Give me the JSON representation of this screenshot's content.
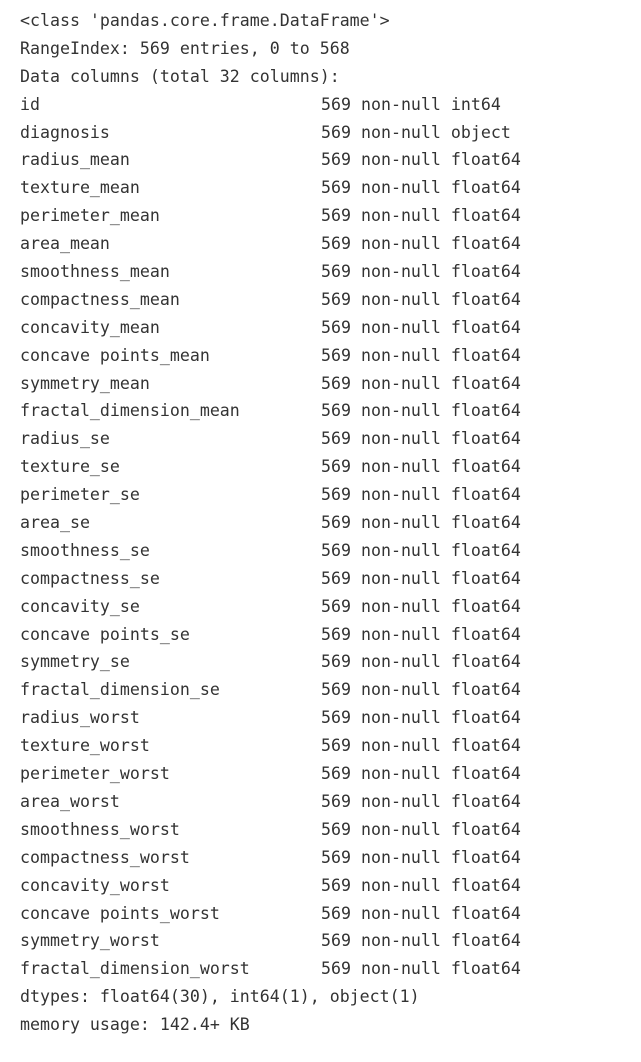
{
  "output": {
    "kind": "pandas-dataframe-info",
    "header_lines": [
      "<class 'pandas.core.frame.DataFrame'>",
      "RangeIndex: 569 entries, 0 to 568",
      "Data columns (total 32 columns):"
    ],
    "class_line": "<class 'pandas.core.frame.DataFrame'>",
    "range_index_line": "RangeIndex: 569 entries, 0 to 568",
    "data_columns_line": "Data columns (total 32 columns):",
    "non_null_label": "non-null",
    "entry_count": "569",
    "total_columns": "32",
    "columns": [
      {
        "name": "id",
        "count": "569",
        "non_null": "non-null",
        "dtype": "int64"
      },
      {
        "name": "diagnosis",
        "count": "569",
        "non_null": "non-null",
        "dtype": "object"
      },
      {
        "name": "radius_mean",
        "count": "569",
        "non_null": "non-null",
        "dtype": "float64"
      },
      {
        "name": "texture_mean",
        "count": "569",
        "non_null": "non-null",
        "dtype": "float64"
      },
      {
        "name": "perimeter_mean",
        "count": "569",
        "non_null": "non-null",
        "dtype": "float64"
      },
      {
        "name": "area_mean",
        "count": "569",
        "non_null": "non-null",
        "dtype": "float64"
      },
      {
        "name": "smoothness_mean",
        "count": "569",
        "non_null": "non-null",
        "dtype": "float64"
      },
      {
        "name": "compactness_mean",
        "count": "569",
        "non_null": "non-null",
        "dtype": "float64"
      },
      {
        "name": "concavity_mean",
        "count": "569",
        "non_null": "non-null",
        "dtype": "float64"
      },
      {
        "name": "concave points_mean",
        "count": "569",
        "non_null": "non-null",
        "dtype": "float64"
      },
      {
        "name": "symmetry_mean",
        "count": "569",
        "non_null": "non-null",
        "dtype": "float64"
      },
      {
        "name": "fractal_dimension_mean",
        "count": "569",
        "non_null": "non-null",
        "dtype": "float64"
      },
      {
        "name": "radius_se",
        "count": "569",
        "non_null": "non-null",
        "dtype": "float64"
      },
      {
        "name": "texture_se",
        "count": "569",
        "non_null": "non-null",
        "dtype": "float64"
      },
      {
        "name": "perimeter_se",
        "count": "569",
        "non_null": "non-null",
        "dtype": "float64"
      },
      {
        "name": "area_se",
        "count": "569",
        "non_null": "non-null",
        "dtype": "float64"
      },
      {
        "name": "smoothness_se",
        "count": "569",
        "non_null": "non-null",
        "dtype": "float64"
      },
      {
        "name": "compactness_se",
        "count": "569",
        "non_null": "non-null",
        "dtype": "float64"
      },
      {
        "name": "concavity_se",
        "count": "569",
        "non_null": "non-null",
        "dtype": "float64"
      },
      {
        "name": "concave points_se",
        "count": "569",
        "non_null": "non-null",
        "dtype": "float64"
      },
      {
        "name": "symmetry_se",
        "count": "569",
        "non_null": "non-null",
        "dtype": "float64"
      },
      {
        "name": "fractal_dimension_se",
        "count": "569",
        "non_null": "non-null",
        "dtype": "float64"
      },
      {
        "name": "radius_worst",
        "count": "569",
        "non_null": "non-null",
        "dtype": "float64"
      },
      {
        "name": "texture_worst",
        "count": "569",
        "non_null": "non-null",
        "dtype": "float64"
      },
      {
        "name": "perimeter_worst",
        "count": "569",
        "non_null": "non-null",
        "dtype": "float64"
      },
      {
        "name": "area_worst",
        "count": "569",
        "non_null": "non-null",
        "dtype": "float64"
      },
      {
        "name": "smoothness_worst",
        "count": "569",
        "non_null": "non-null",
        "dtype": "float64"
      },
      {
        "name": "compactness_worst",
        "count": "569",
        "non_null": "non-null",
        "dtype": "float64"
      },
      {
        "name": "concavity_worst",
        "count": "569",
        "non_null": "non-null",
        "dtype": "float64"
      },
      {
        "name": "concave points_worst",
        "count": "569",
        "non_null": "non-null",
        "dtype": "float64"
      },
      {
        "name": "symmetry_worst",
        "count": "569",
        "non_null": "non-null",
        "dtype": "float64"
      },
      {
        "name": "fractal_dimension_worst",
        "count": "569",
        "non_null": "non-null",
        "dtype": "float64"
      }
    ],
    "dtypes_line": "dtypes: float64(30), int64(1), object(1)",
    "memory_usage_line": "memory usage: 142.4+ KB"
  },
  "colors": {
    "background": "#ffffff",
    "text": "#333333"
  }
}
